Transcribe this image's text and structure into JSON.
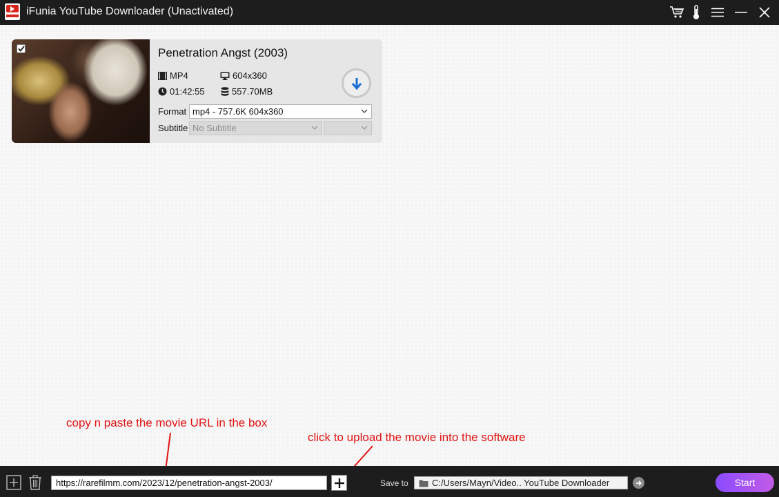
{
  "window": {
    "title": "iFunia YouTube Downloader (Unactivated)",
    "icons": [
      "cart-icon",
      "thermometer-icon",
      "menu-icon",
      "minimize-icon",
      "close-icon"
    ]
  },
  "video": {
    "checked": true,
    "title": "Penetration Angst (2003)",
    "container": "MP4",
    "resolution": "604x360",
    "duration": "01:42:55",
    "size": "557.70MB",
    "format_label": "Format",
    "format_value": "mp4 - 757.6K 604x360",
    "subtitle_label": "Subtitle",
    "subtitle_value": "No Subtitle",
    "subtitle_lang_value": ""
  },
  "annotations": {
    "paste_hint": "copy n paste the movie URL in the box",
    "upload_hint": "click to upload the movie into the software"
  },
  "bottombar": {
    "url_value": "https://rarefilmm.com/2023/12/penetration-angst-2003/",
    "save_to_label": "Save to",
    "save_path": "C:/Users/Mayn/Video.. YouTube Downloader",
    "start_label": "Start"
  },
  "colors": {
    "titlebar": "#1d1d1d",
    "annotation": "#e31212",
    "accent_download": "#1a6fd1",
    "start_gradient_start": "#8a4bff",
    "start_gradient_end": "#c25be6"
  }
}
